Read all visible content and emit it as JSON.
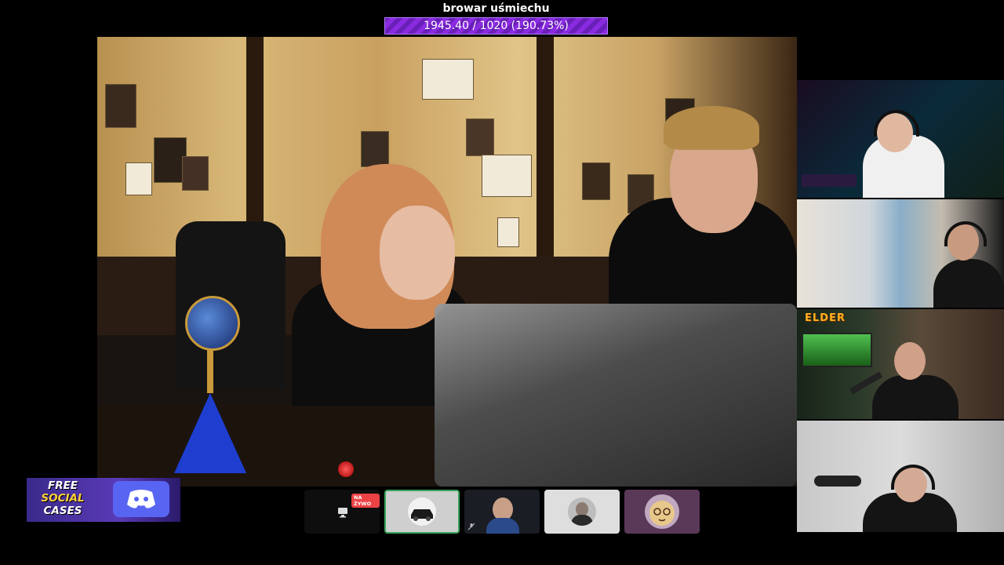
{
  "goal": {
    "title": "browar uśmiechu",
    "progress_text": "1945.40 / 1020 (190.73%)",
    "current": 1945.4,
    "target": 1020,
    "percent": 190.73,
    "bar_color": "#8a2be2"
  },
  "promo": {
    "line1": "FREE",
    "line2": "SOCIAL",
    "line3": "CASES",
    "icon": "discord-icon"
  },
  "call_tiles": [
    {
      "name": "tile-screen-share",
      "badge": "NA ŻYWO",
      "icon": "monitor-icon"
    },
    {
      "name": "tile-car-avatar",
      "speaking": true
    },
    {
      "name": "tile-participant-video",
      "icon": "mic-muted-icon"
    },
    {
      "name": "tile-participant-avatar"
    },
    {
      "name": "tile-cat-avatar"
    }
  ],
  "side_cams": [
    {
      "name": "streamer-cam-gaming-room"
    },
    {
      "name": "streamer-cam-apartment"
    },
    {
      "name": "streamer-cam-elder",
      "logo": "ELDER"
    },
    {
      "name": "streamer-cam-podcast"
    }
  ],
  "colors": {
    "goal_bar": "#8a2be2",
    "speaking_border": "#3ba55c",
    "live_badge": "#ed4245",
    "discord_blurple": "#5865f2"
  }
}
